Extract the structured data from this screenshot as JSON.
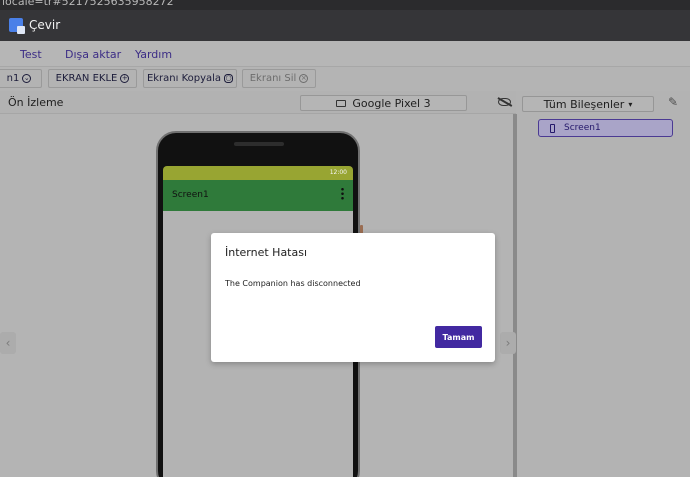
{
  "browser": {
    "url_fragment": "locale=tr#5217525635958272",
    "translate_label": "Çevir"
  },
  "menu": {
    "items": [
      "Test",
      "Dışa aktar",
      "Yardım"
    ]
  },
  "toolbar": {
    "screen_select": "n1",
    "add_screen": "EKRAN EKLE",
    "copy_screen": "Ekranı Kopyala",
    "delete_screen": "Ekranı Sil"
  },
  "viewer": {
    "label": "Ön İzleme",
    "device": "Google Pixel 3"
  },
  "phone": {
    "time": "12:00",
    "screen_title": "Screen1"
  },
  "components": {
    "filter": "Tüm Bileşenler",
    "tree": [
      "Screen1"
    ]
  },
  "dialog": {
    "title": "İnternet Hatası",
    "message": "The Companion has disconnected",
    "ok_label": "Tamam"
  },
  "colors": {
    "accent": "#4229a1",
    "status_bar": "#98a532",
    "app_bar": "#2f7a3a"
  }
}
